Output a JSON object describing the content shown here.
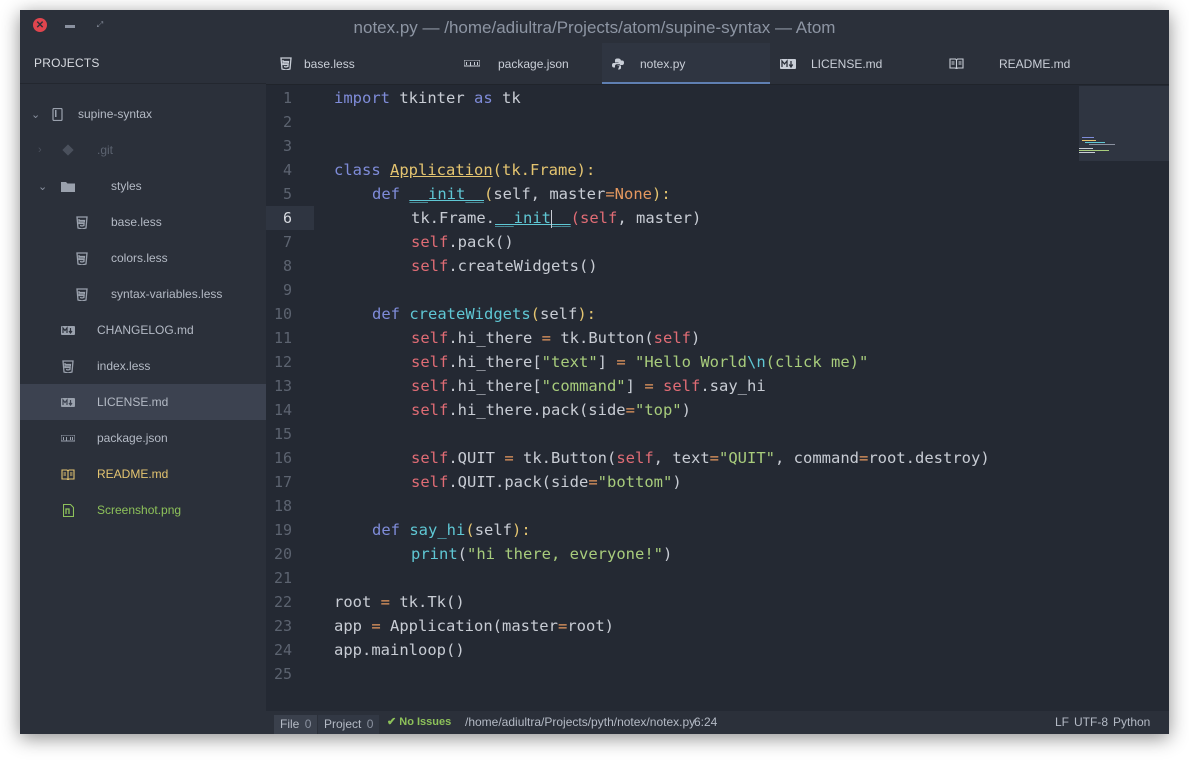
{
  "window": {
    "title": "notex.py — /home/adiultra/Projects/atom/supine-syntax — Atom"
  },
  "sidebar": {
    "header": "PROJECTS",
    "items": [
      {
        "label": "supine-syntax",
        "icon": "repo-icon"
      },
      {
        "label": ".git",
        "icon": "git-icon"
      },
      {
        "label": "styles",
        "icon": "folder-icon"
      },
      {
        "label": "base.less",
        "icon": "css-icon"
      },
      {
        "label": "colors.less",
        "icon": "css-icon"
      },
      {
        "label": "syntax-variables.less",
        "icon": "css-icon"
      },
      {
        "label": "CHANGELOG.md",
        "icon": "markdown-icon"
      },
      {
        "label": "index.less",
        "icon": "css-icon"
      },
      {
        "label": "LICENSE.md",
        "icon": "markdown-icon"
      },
      {
        "label": "package.json",
        "icon": "npm-icon"
      },
      {
        "label": "README.md",
        "icon": "book-icon"
      },
      {
        "label": "Screenshot.png",
        "icon": "image-icon"
      }
    ],
    "colors": {
      "git": "#5c6370",
      "readme": "#e4c470",
      "screenshot": "#8dc15a"
    }
  },
  "tabs": [
    {
      "label": "base.less",
      "icon": "css-icon"
    },
    {
      "label": "package.json",
      "icon": "npm-icon"
    },
    {
      "label": "notex.py",
      "icon": "python-icon",
      "active": true
    },
    {
      "label": "LICENSE.md",
      "icon": "markdown-icon"
    },
    {
      "label": "README.md",
      "icon": "book-icon"
    }
  ],
  "editor": {
    "current_line": 6,
    "line_numbers": [
      "1",
      "2",
      "3",
      "4",
      "5",
      "6",
      "7",
      "8",
      "9",
      "10",
      "11",
      "12",
      "13",
      "14",
      "15",
      "16",
      "17",
      "18",
      "19",
      "20",
      "21",
      "22",
      "23",
      "24",
      "25"
    ],
    "lines": {
      "l1": {
        "a": "import",
        "b": " tkinter ",
        "c": "as",
        "d": " tk"
      },
      "l4": {
        "a": "class",
        "b": "Application",
        "c": "(",
        "d": "tk.Frame",
        "e": "):"
      },
      "l5": {
        "a": "def",
        "b": "__init__",
        "c": "(",
        "d": "self, master",
        "e": "=",
        "f": "None",
        "g": "):"
      },
      "l6": {
        "a": "tk.Frame.",
        "b": "__init",
        "c": "__",
        "d": "(",
        "e": "self",
        "f": ", master)"
      },
      "l7": {
        "a": "self",
        "b": ".pack()"
      },
      "l8": {
        "a": "self",
        "b": ".createWidgets()"
      },
      "l10": {
        "a": "def",
        "b": "createWidgets",
        "c": "(",
        "d": "self",
        "e": "):"
      },
      "l11": {
        "a": "self",
        "b": ".hi_there ",
        "c": "=",
        "d": " tk.Button(",
        "e": "self",
        "f": ")"
      },
      "l12": {
        "a": "self",
        "b": ".hi_there[",
        "c": "\"text\"",
        "d": "] ",
        "e": "=",
        "f": " ",
        "g": "\"Hello World",
        "h": "\\n",
        "i": "(click me)\""
      },
      "l13": {
        "a": "self",
        "b": ".hi_there[",
        "c": "\"command\"",
        "d": "] ",
        "e": "=",
        "f": " ",
        "g": "self",
        "h": ".say_hi"
      },
      "l14": {
        "a": "self",
        "b": ".hi_there.pack(side",
        "c": "=",
        "d": "\"top\"",
        "e": ")"
      },
      "l16": {
        "a": "self",
        "b": ".QUIT ",
        "c": "=",
        "d": " tk.Button(",
        "e": "self",
        "f": ", text",
        "g": "=",
        "h": "\"QUIT\"",
        "i": ", command",
        "j": "=",
        "k": "root.destroy)"
      },
      "l17": {
        "a": "self",
        "b": ".QUIT.pack(side",
        "c": "=",
        "d": "\"bottom\"",
        "e": ")"
      },
      "l19": {
        "a": "def",
        "b": "say_hi",
        "c": "(",
        "d": "self",
        "e": "):"
      },
      "l20": {
        "a": "print",
        "b": "(",
        "c": "\"hi there, everyone!\"",
        "d": ")"
      },
      "l22": {
        "a": "root ",
        "b": "=",
        "c": " tk.Tk()"
      },
      "l23": {
        "a": "app ",
        "b": "=",
        "c": " Application(master",
        "d": "=",
        "e": "root)"
      },
      "l24": {
        "a": "app.mainloop()"
      }
    }
  },
  "statusbar": {
    "file_label": "File",
    "file_count": "0",
    "project_label": "Project",
    "project_count": "0",
    "issues": "No Issues",
    "path": "/home/adiultra/Projects/pyth/notex/notex.py",
    "cursor_pos": "6:24",
    "line_ending": "LF",
    "encoding": "UTF-8",
    "grammar": "Python"
  }
}
